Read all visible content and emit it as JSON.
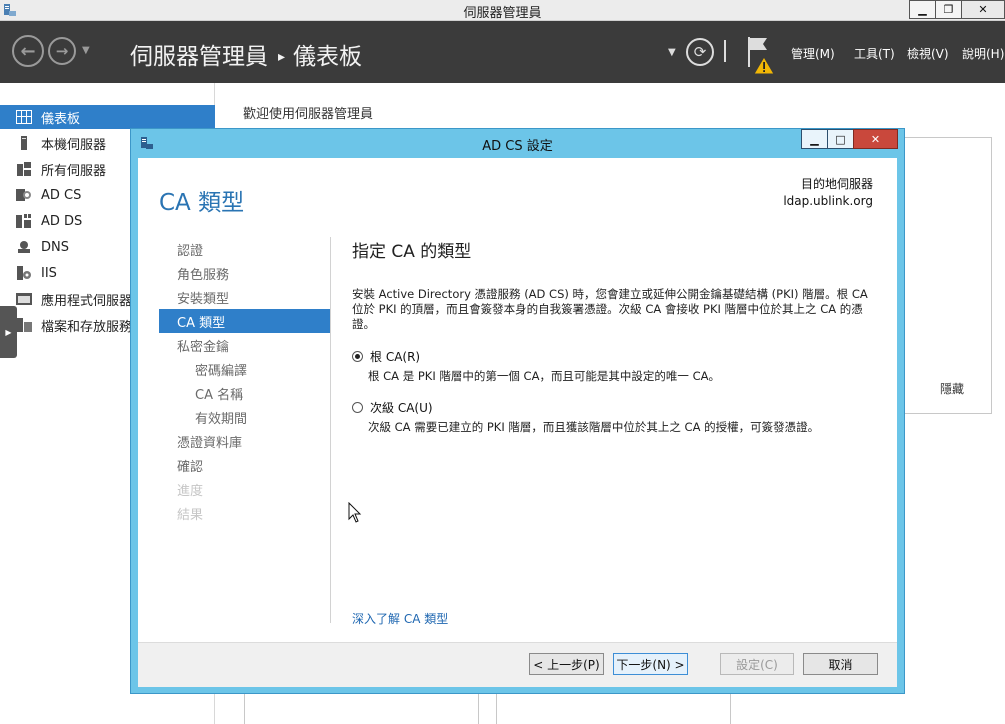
{
  "window": {
    "title": "伺服器管理員"
  },
  "header": {
    "breadcrumb_root": "伺服器管理員",
    "breadcrumb_separator": "▸",
    "breadcrumb_current": "儀表板",
    "menus": [
      "管理(M)",
      "工具(T)",
      "檢視(V)",
      "說明(H)"
    ]
  },
  "sidebar": {
    "items": [
      {
        "label": "儀表板",
        "icon": "dashboard-icon",
        "active": true
      },
      {
        "label": "本機伺服器",
        "icon": "server-icon"
      },
      {
        "label": "所有伺服器",
        "icon": "servers-icon"
      },
      {
        "label": "AD CS",
        "icon": "certificate-icon"
      },
      {
        "label": "AD DS",
        "icon": "directory-icon"
      },
      {
        "label": "DNS",
        "icon": "dns-icon"
      },
      {
        "label": "IIS",
        "icon": "iis-icon"
      },
      {
        "label": "應用程式伺服器",
        "icon": "app-server-icon"
      },
      {
        "label": "檔案和存放服務",
        "icon": "file-storage-icon"
      }
    ]
  },
  "background": {
    "welcome": "歡迎使用伺服器管理員",
    "hide_label": "隱藏"
  },
  "dialog": {
    "title": "AD CS 設定",
    "page_title": "CA 類型",
    "destination_label": "目的地伺服器",
    "destination_server": "ldap.ublink.org",
    "section_title": "指定 CA 的類型",
    "description": "安裝 Active Directory 憑證服務 (AD CS) 時，您會建立或延伸公開金鑰基礎結構 (PKI) 階層。根 CA 位於 PKI 的頂層，而且會簽發本身的自我簽署憑證。次級 CA 會接收 PKI 階層中位於其上之 CA 的憑證。",
    "options": [
      {
        "label": "根 CA(R)",
        "selected": true,
        "description": "根 CA 是 PKI 階層中的第一個 CA，而且可能是其中設定的唯一 CA。"
      },
      {
        "label": "次級 CA(U)",
        "selected": false,
        "description": "次級 CA 需要已建立的 PKI 階層，而且獲該階層中位於其上之 CA 的授權，可簽發憑證。"
      }
    ],
    "learn_more": "深入了解 CA 類型",
    "steps": [
      {
        "label": "認證",
        "state": "normal",
        "level": 0
      },
      {
        "label": "角色服務",
        "state": "normal",
        "level": 0
      },
      {
        "label": "安裝類型",
        "state": "normal",
        "level": 0
      },
      {
        "label": "CA 類型",
        "state": "active",
        "level": 0
      },
      {
        "label": "私密金鑰",
        "state": "normal",
        "level": 0
      },
      {
        "label": "密碼編譯",
        "state": "normal",
        "level": 1
      },
      {
        "label": "CA 名稱",
        "state": "normal",
        "level": 1
      },
      {
        "label": "有效期間",
        "state": "normal",
        "level": 1
      },
      {
        "label": "憑證資料庫",
        "state": "normal",
        "level": 0
      },
      {
        "label": "確認",
        "state": "normal",
        "level": 0
      },
      {
        "label": "進度",
        "state": "disabled",
        "level": 0
      },
      {
        "label": "結果",
        "state": "disabled",
        "level": 0
      }
    ],
    "buttons": {
      "previous": "< 上一步(P)",
      "next": "下一步(N) >",
      "configure": "設定(C)",
      "cancel": "取消"
    }
  },
  "colors": {
    "header_bg": "#3b3b3b",
    "accent_blue": "#2f7fc9",
    "dialog_frame": "#6cc5e8",
    "title_blue": "#2a74b3",
    "close_red": "#c9483c",
    "warning_yellow": "#f2b705"
  }
}
